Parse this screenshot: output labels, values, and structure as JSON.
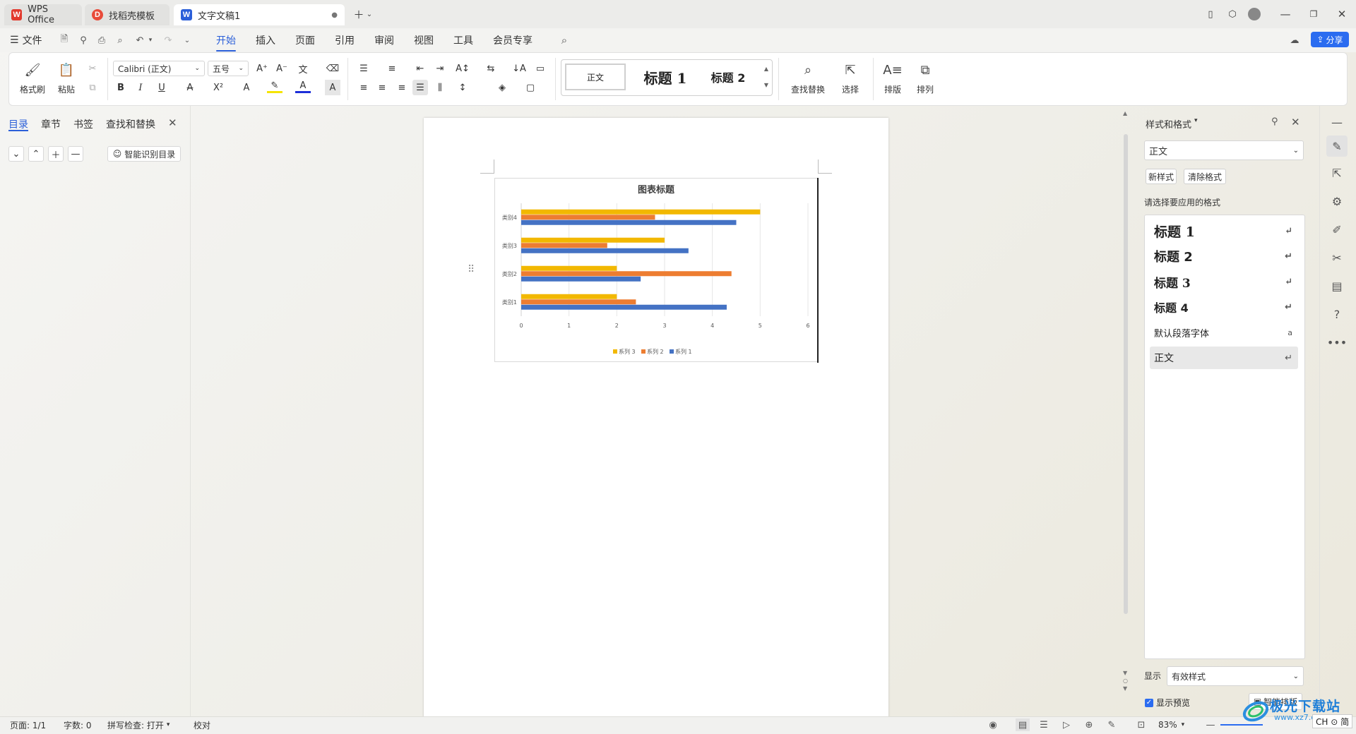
{
  "tabs": [
    {
      "label": "WPS Office",
      "icon": "wps-logo-icon"
    },
    {
      "label": "找稻壳模板",
      "icon": "docer-icon"
    },
    {
      "label": "文字文稿1",
      "icon": "word-doc-icon"
    }
  ],
  "menu": {
    "file": "文件",
    "items": [
      "开始",
      "插入",
      "页面",
      "引用",
      "审阅",
      "视图",
      "工具",
      "会员专享"
    ],
    "active": "开始",
    "share": "分享"
  },
  "ribbon": {
    "format_painter": "格式刷",
    "paste": "粘贴",
    "font_name": "Calibri (正文)",
    "font_size": "五号",
    "styles": [
      "正文",
      "标题 1",
      "标题 2"
    ],
    "find_replace": "查找替换",
    "select": "选择",
    "layout": "排版",
    "arrange": "排列"
  },
  "nav": {
    "tabs": [
      "目录",
      "章节",
      "书签",
      "查找和替换"
    ],
    "smart_toc": "智能识别目录"
  },
  "chart_data": {
    "type": "bar",
    "orientation": "horizontal",
    "title": "图表标题",
    "categories": [
      "类别1",
      "类别2",
      "类别3",
      "类别4"
    ],
    "series": [
      {
        "name": "系列 1",
        "color": "#4472c4",
        "values": [
          4.3,
          2.5,
          3.5,
          4.5
        ]
      },
      {
        "name": "系列 2",
        "color": "#ed7d31",
        "values": [
          2.4,
          4.4,
          1.8,
          2.8
        ]
      },
      {
        "name": "系列 3",
        "color": "#f2b800",
        "values": [
          2.0,
          2.0,
          3.0,
          5.0
        ]
      }
    ],
    "xlim": [
      0,
      6
    ],
    "xticks": [
      "0",
      "1",
      "2",
      "3",
      "4",
      "5",
      "6"
    ],
    "legend_placement": "bottom",
    "grid": true
  },
  "style_panel": {
    "title": "样式和格式",
    "current_style": "正文",
    "new_style": "新样式",
    "clear_format": "清除格式",
    "prompt": "请选择要应用的格式",
    "styles": [
      {
        "label": "标题 1",
        "mark": "↵"
      },
      {
        "label": "标题 2",
        "mark": "↵"
      },
      {
        "label": "标题 3",
        "mark": "↵"
      },
      {
        "label": "标题 4",
        "mark": "↵"
      },
      {
        "label": "默认段落字体",
        "mark": "a"
      },
      {
        "label": "正文",
        "mark": "↵"
      }
    ],
    "show_label": "显示",
    "show_value": "有效样式",
    "preview_label": "显示预览",
    "smart_layout": "智能排版"
  },
  "status": {
    "page": "页面: 1/1",
    "words": "字数: 0",
    "spellcheck": "拼写检查: 打开",
    "proof": "校对",
    "zoom": "83%"
  },
  "watermark": {
    "text": "极光下载站",
    "url": "www.xz7.com",
    "ime": "CH ⊙ 简"
  }
}
